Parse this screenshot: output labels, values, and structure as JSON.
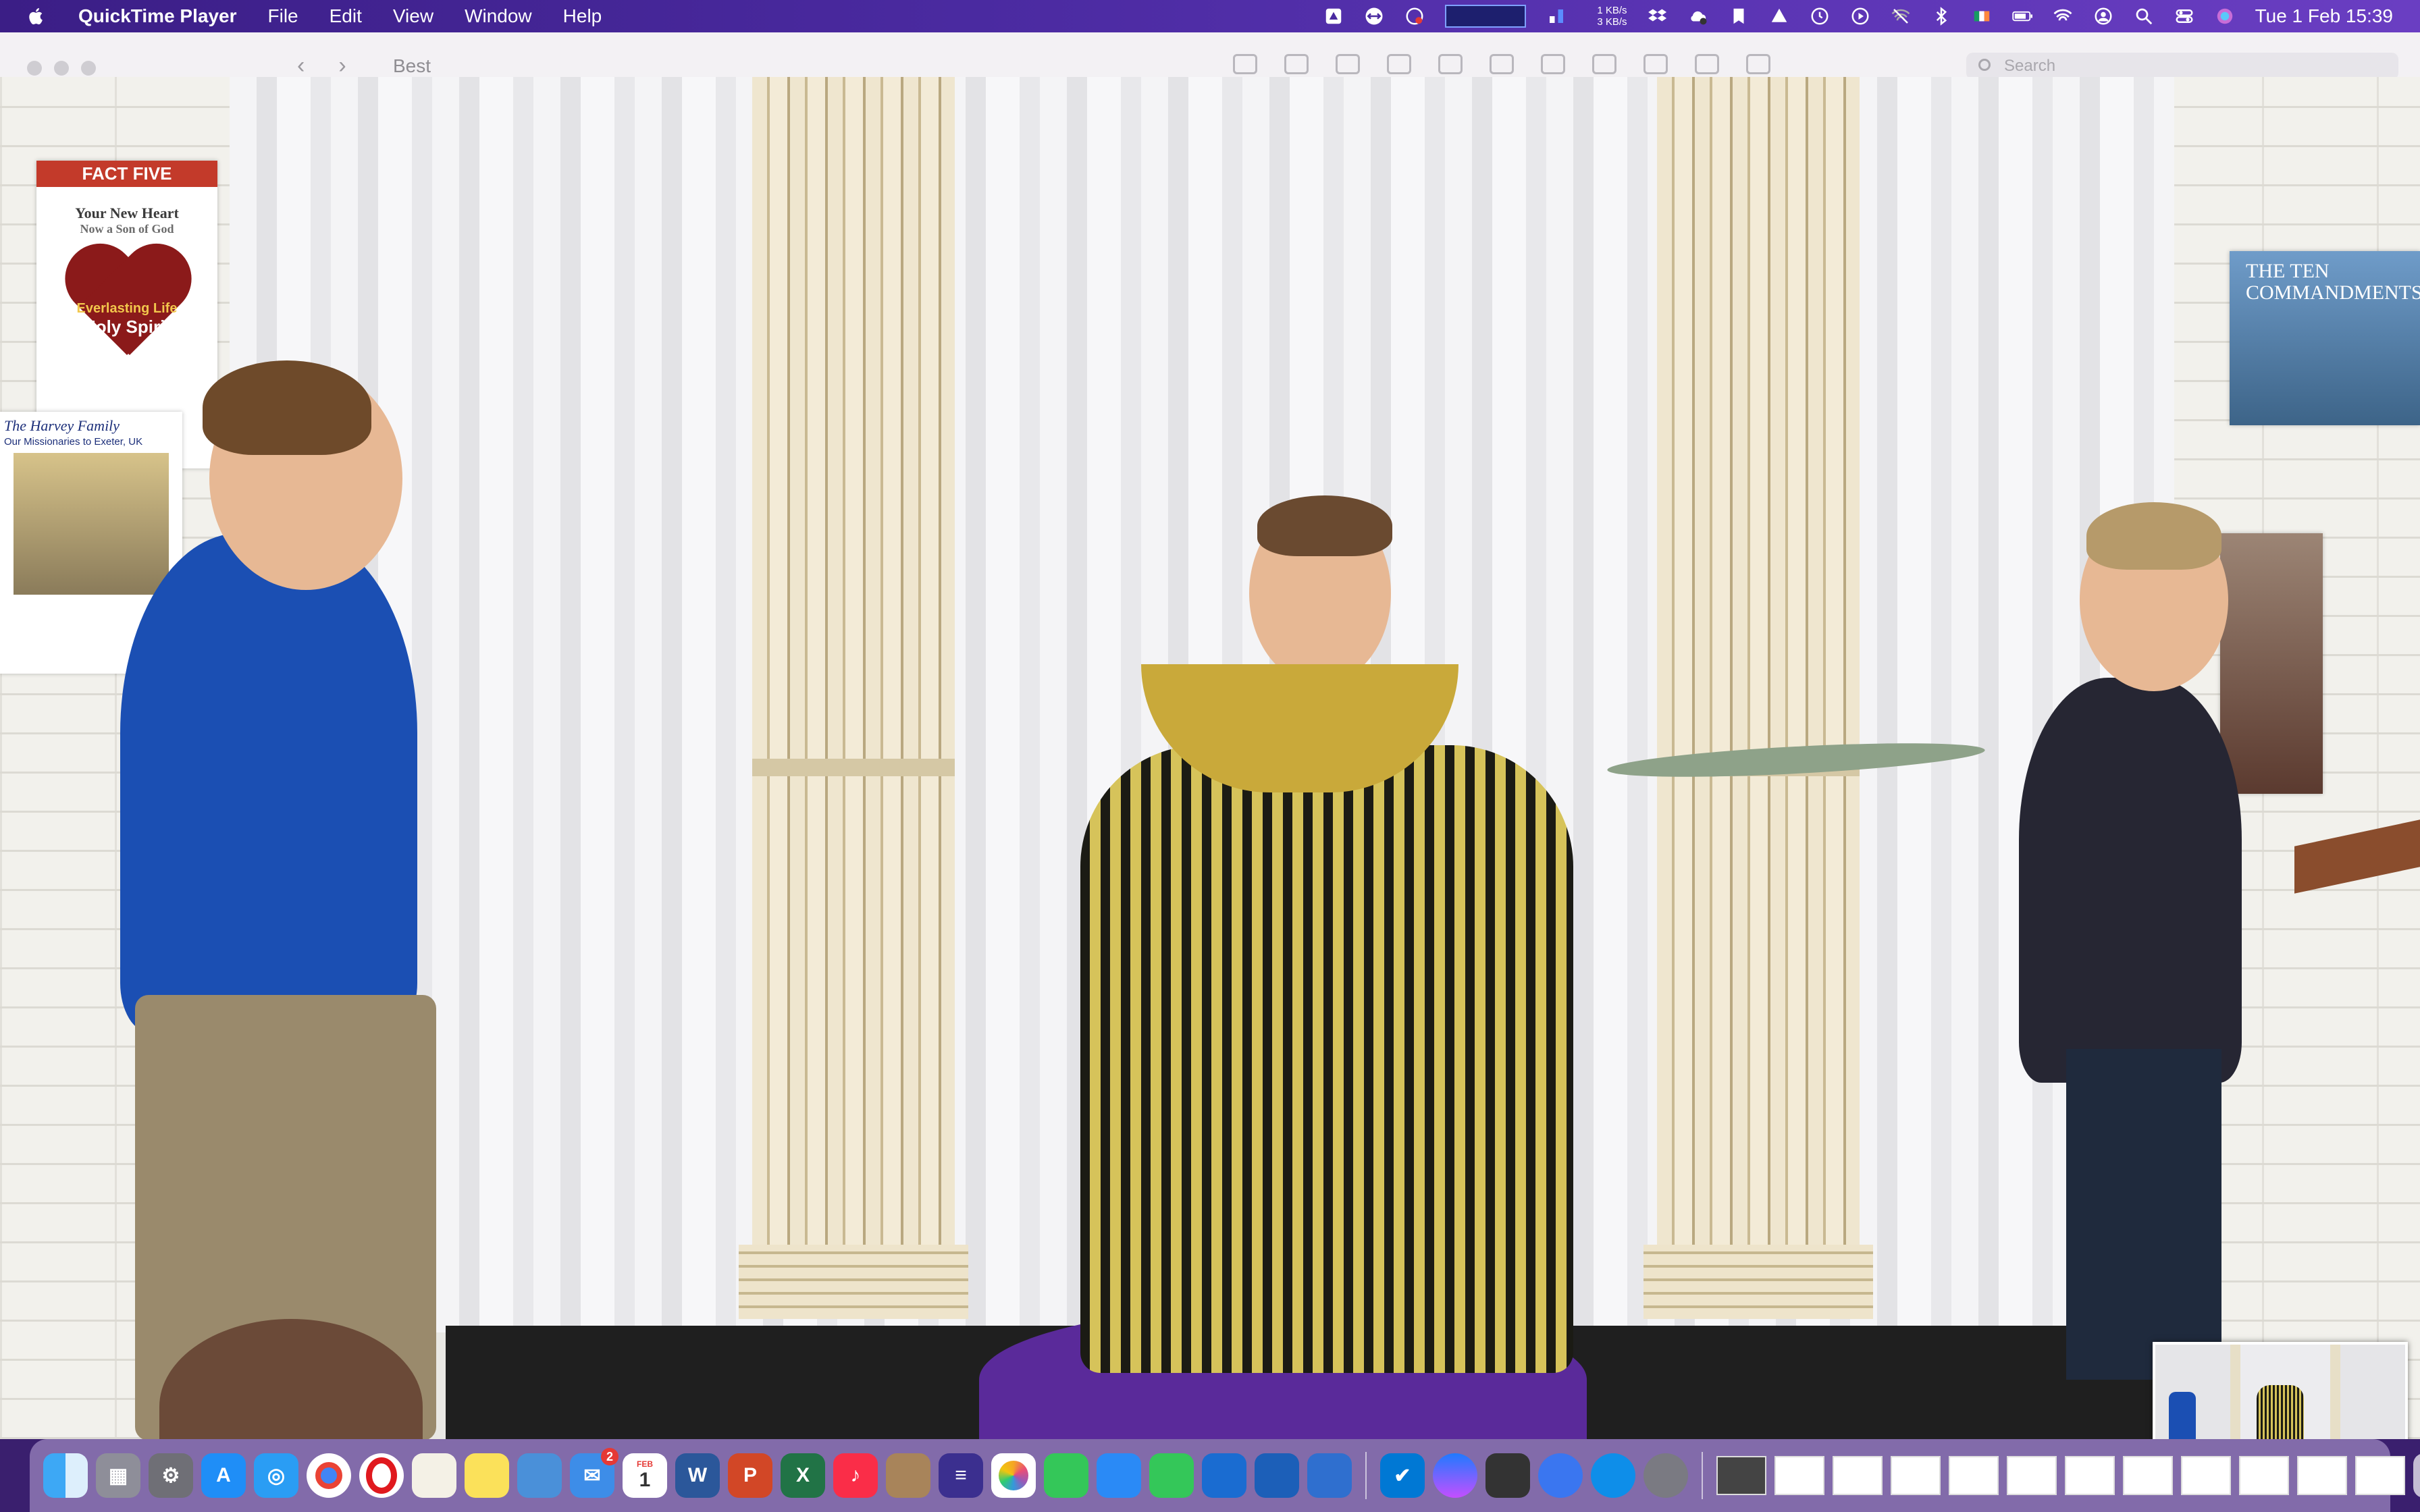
{
  "menubar": {
    "app_name": "QuickTime Player",
    "menus": [
      "File",
      "Edit",
      "View",
      "Window",
      "Help"
    ],
    "net_up": "1 KB/s",
    "net_down": "3 KB/s",
    "clock": "Tue 1 Feb  15:39"
  },
  "finder_window": {
    "title": "Best",
    "search_placeholder": "Search"
  },
  "video": {
    "poster_fact": {
      "header": "FACT FIVE",
      "line1": "Your New Heart",
      "line2": "Now a Son of God",
      "heart_line1": "Everlasting Life",
      "heart_line2": "Holy Spirit"
    },
    "poster_family": {
      "title": "The Harvey Family",
      "subtitle": "Our Missionaries to Exeter, UK"
    },
    "poster_commandments": {
      "title": "THE TEN COMMANDMENTS"
    }
  },
  "dock": {
    "mail_badge": "2",
    "calendar_month": "FEB",
    "calendar_day": "1",
    "word_letter": "W",
    "excel_letter": "X",
    "ppt_letter": "P"
  }
}
